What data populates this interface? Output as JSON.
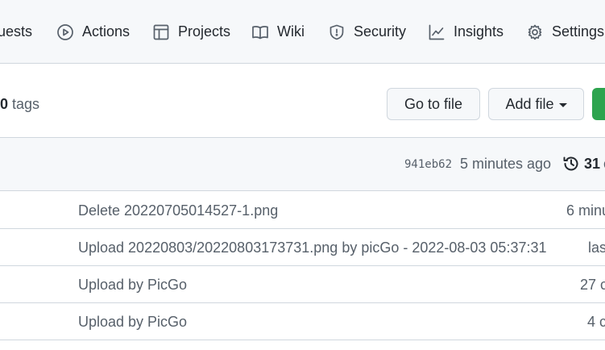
{
  "nav": {
    "items": [
      {
        "label": "uests",
        "icon": "pull-request-icon"
      },
      {
        "label": "Actions",
        "icon": "play-icon"
      },
      {
        "label": "Projects",
        "icon": "table-icon"
      },
      {
        "label": "Wiki",
        "icon": "book-icon"
      },
      {
        "label": "Security",
        "icon": "shield-icon"
      },
      {
        "label": "Insights",
        "icon": "graph-icon"
      },
      {
        "label": "Settings",
        "icon": "gear-icon"
      }
    ]
  },
  "branch": {
    "tag_count": "0",
    "tag_label": "tags",
    "go_to_file": "Go to file",
    "add_file": "Add file"
  },
  "commit": {
    "sha": "941eb62",
    "time": "5 minutes ago",
    "count": "31",
    "count_suffix": "c"
  },
  "files": [
    {
      "message": "Delete 20220705014527-1.png",
      "age": "6 minu"
    },
    {
      "message": "Upload 20220803/20220803173731.png by picGo - 2022-08-03 05:37:31",
      "age": "las"
    },
    {
      "message": "Upload by PicGo",
      "age": "27 c"
    },
    {
      "message": "Upload by PicGo",
      "age": "4 c"
    }
  ],
  "colors": {
    "nav_bg": "#f6f8fa",
    "border": "#d0d7de",
    "primary_button": "#2da44e",
    "muted_text": "#57606a"
  }
}
